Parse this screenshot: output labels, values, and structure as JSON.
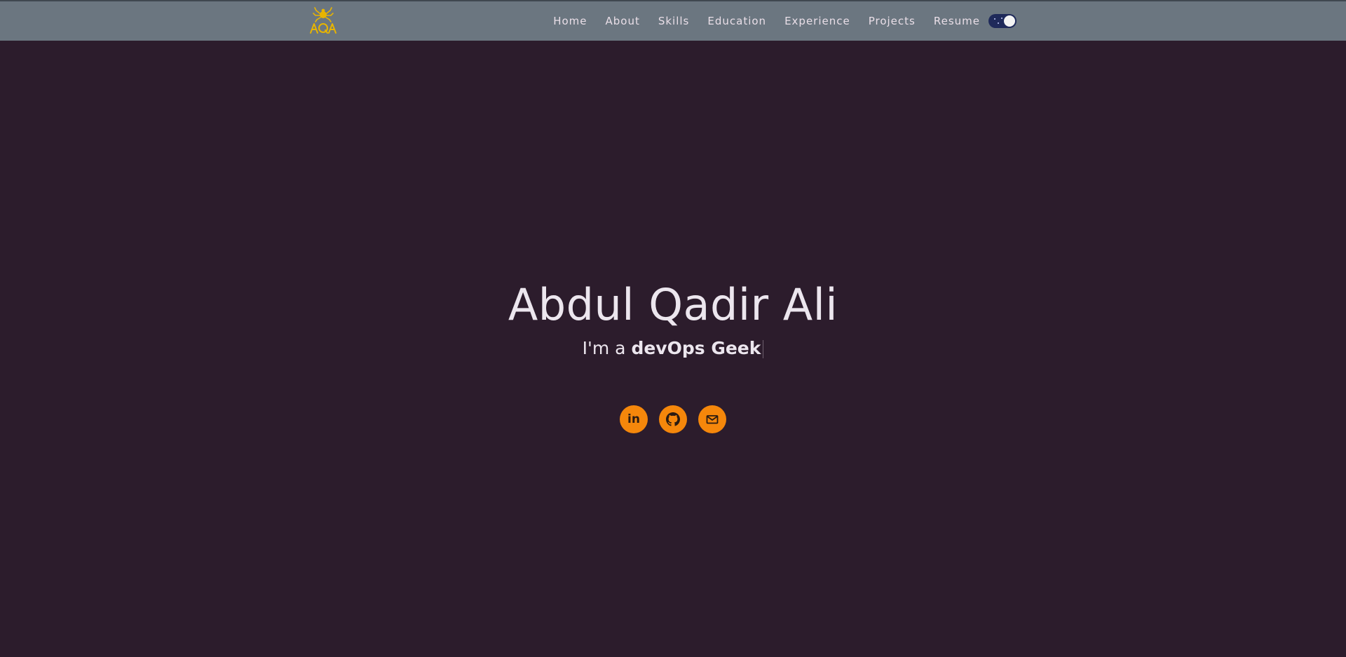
{
  "nav": {
    "logo_icon": "aqa-logo-icon",
    "links": [
      "Home",
      "About",
      "Skills",
      "Education",
      "Experience",
      "Projects",
      "Resume"
    ],
    "theme_toggle": {
      "state": "dark"
    }
  },
  "hero": {
    "name": "Abdul Qadir Ali",
    "tagline_prefix": "I'm a ",
    "tagline_role": "devOps Geek"
  },
  "socials": [
    {
      "icon": "linkedin-icon",
      "text": "in"
    },
    {
      "icon": "github-icon"
    },
    {
      "icon": "mail-icon"
    }
  ],
  "colors": {
    "background": "#2c1c2c",
    "navbar": "#6b7680",
    "accent": "#f5870b",
    "logo": "#e8b400",
    "text": "#ece6ee"
  }
}
